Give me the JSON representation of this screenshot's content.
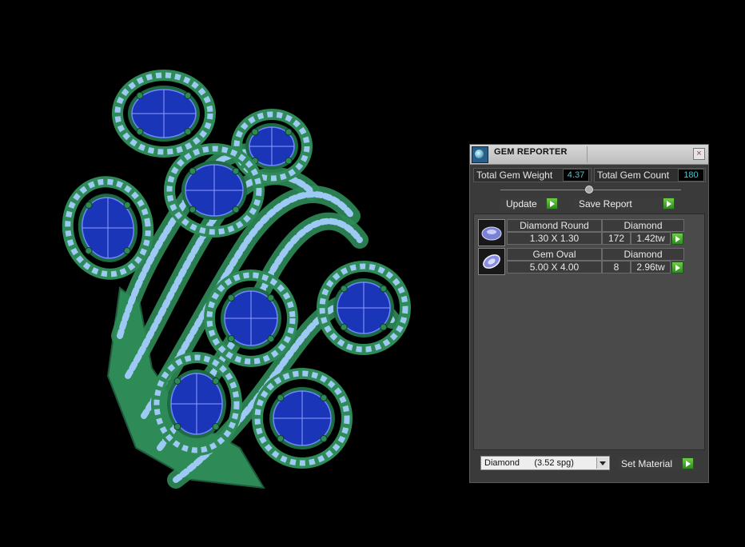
{
  "panel": {
    "title": "GEM REPORTER",
    "close_label": "×",
    "total_weight_label": "Total Gem Weight",
    "total_weight_value": "4.37",
    "total_count_label": "Total Gem Count",
    "total_count_value": "180",
    "update_label": "Update",
    "save_report_label": "Save Report",
    "gems": [
      {
        "shape": "Diamond Round",
        "material": "Diamond",
        "size": "1.30 X 1.30",
        "count": "172",
        "weight": "1.42tw"
      },
      {
        "shape": "Gem Oval",
        "material": "Diamond",
        "size": "5.00 X 4.00",
        "count": "8",
        "weight": "2.96tw"
      }
    ],
    "material_select": "Diamond      (3.52 spg)",
    "set_material_label": "Set Material"
  },
  "colors": {
    "background": "#000000",
    "metal": "#2e8b57",
    "gem_round": "#9ec9f5",
    "gem_oval": "#1a35b8",
    "value_text": "#4fc3d0",
    "button_green": "#4caf2a"
  },
  "icons": {
    "app": "gem-reporter-icon",
    "close": "close-icon",
    "go": "green-arrow-icon",
    "dropdown": "chevron-down-icon"
  }
}
